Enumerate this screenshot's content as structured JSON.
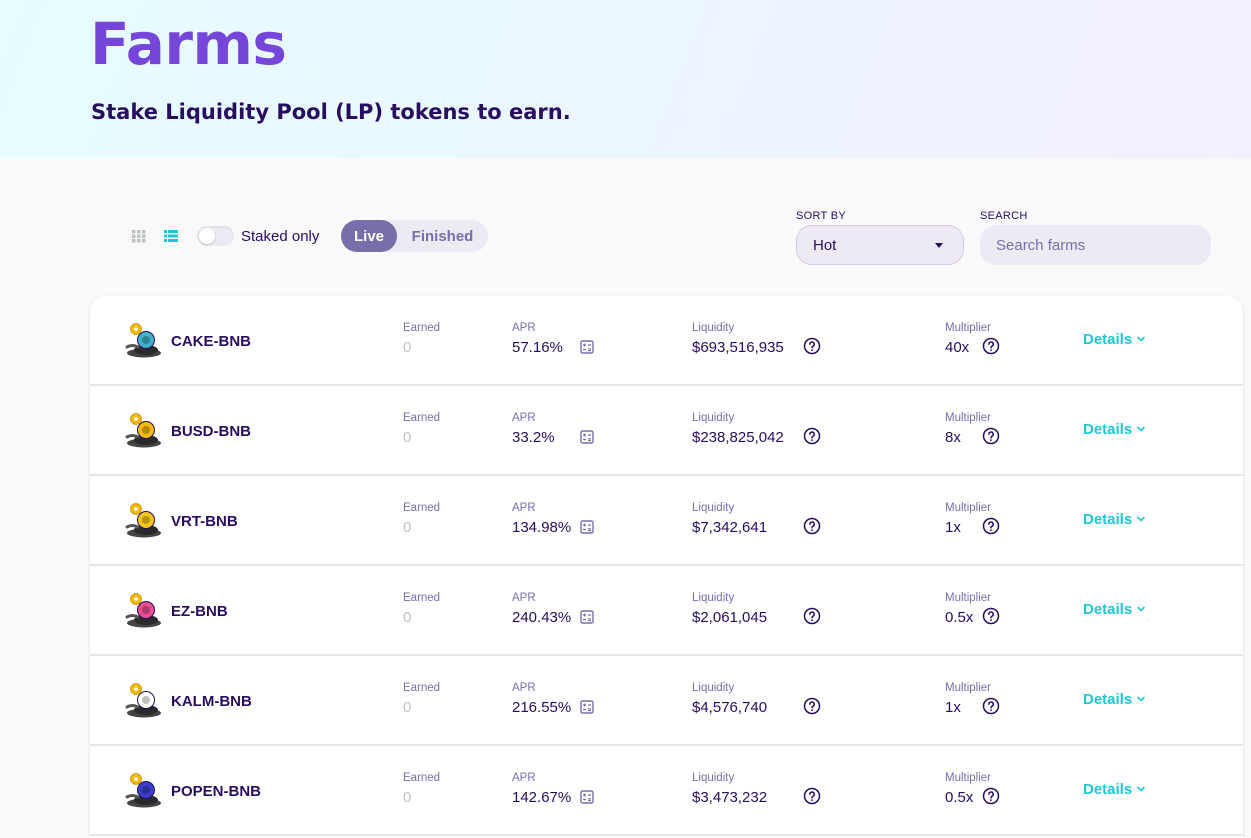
{
  "header": {
    "title": "Farms",
    "subtitle": "Stake Liquidity Pool (LP) tokens to earn."
  },
  "controls": {
    "staked_only_label": "Staked only",
    "tabs": {
      "live": "Live",
      "finished": "Finished"
    },
    "sort_label": "SORT BY",
    "sort_value": "Hot",
    "search_label": "SEARCH",
    "search_placeholder": "Search farms"
  },
  "columns": {
    "earned": "Earned",
    "apr": "APR",
    "liquidity": "Liquidity",
    "multiplier": "Multiplier",
    "details": "Details"
  },
  "farms": [
    {
      "pair": "CAKE-BNB",
      "token_color": "#3fb2c4",
      "earned": "0",
      "apr": "57.16%",
      "liquidity": "$693,516,935",
      "multiplier": "40x"
    },
    {
      "pair": "BUSD-BNB",
      "token_color": "#f0b90b",
      "earned": "0",
      "apr": "33.2%",
      "liquidity": "$238,825,042",
      "multiplier": "8x"
    },
    {
      "pair": "VRT-BNB",
      "token_color": "#f5c518",
      "earned": "0",
      "apr": "134.98%",
      "liquidity": "$7,342,641",
      "multiplier": "1x"
    },
    {
      "pair": "EZ-BNB",
      "token_color": "#e94e8f",
      "earned": "0",
      "apr": "240.43%",
      "liquidity": "$2,061,045",
      "multiplier": "0.5x"
    },
    {
      "pair": "KALM-BNB",
      "token_color": "#ffffff",
      "earned": "0",
      "apr": "216.55%",
      "liquidity": "$4,576,740",
      "multiplier": "1x"
    },
    {
      "pair": "POPEN-BNB",
      "token_color": "#3b3ec7",
      "earned": "0",
      "apr": "142.67%",
      "liquidity": "$3,473,232",
      "multiplier": "0.5x"
    }
  ],
  "colors": {
    "primary": "#7645d9",
    "text": "#280d5f",
    "secondary": "#7a6eaa",
    "accent": "#1fc7d4",
    "bnb": "#f0b90b"
  }
}
